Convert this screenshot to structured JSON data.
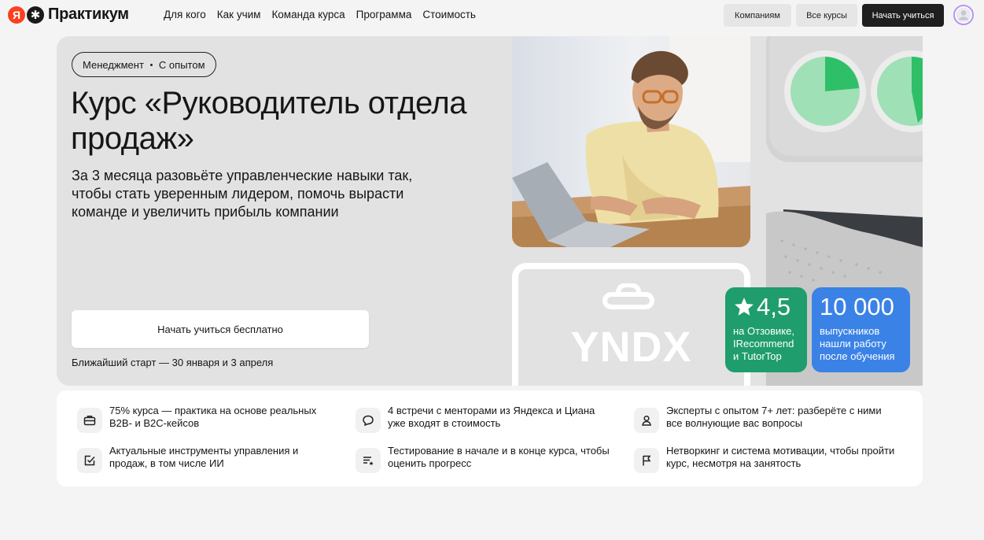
{
  "header": {
    "logo": {
      "ya_letter": "Я",
      "text": "Практикум"
    },
    "nav": [
      "Для кого",
      "Как учим",
      "Команда курса",
      "Программа",
      "Стоимость"
    ],
    "buttons": {
      "companies": "Компаниям",
      "all_courses": "Все курсы",
      "start": "Начать учиться"
    }
  },
  "hero": {
    "tag": {
      "category": "Менеджмент",
      "level": "С опытом"
    },
    "title": "Курс «Руководитель отдела продаж»",
    "subtitle": "За 3 месяца разовьёте управленческие навыки так, чтобы стать уверенным лидером, помочь вырасти команде и увеличить прибыль компании",
    "cta": "Начать учиться бесплатно",
    "next_start": "Ближайший старт — 30 января и 3 апреля",
    "card_text": "YNDX",
    "rating": {
      "value": "4,5",
      "caption": "на Отзовике, IRecommend и TutorTop"
    },
    "graduates": {
      "value": "10 000",
      "caption": "выпускников нашли работу после обучения"
    }
  },
  "features": [
    {
      "icon": "briefcase-icon",
      "text": "75% курса — практика на основе реальных B2B- и B2C-кейсов"
    },
    {
      "icon": "chat-icon",
      "text": "4 встречи с менторами из Яндекса и Циана уже входят в стоимость"
    },
    {
      "icon": "person-icon",
      "text": "Эксперты с опытом 7+ лет: разберёте с ними все волнующие вас вопросы"
    },
    {
      "icon": "checkbox-icon",
      "text": "Актуальные инструменты управления и продаж, в том числе ИИ"
    },
    {
      "icon": "list-star-icon",
      "text": "Тестирование в начале и в конце курса, чтобы оценить прогресс"
    },
    {
      "icon": "flag-icon",
      "text": "Нетворкинг и система мотивации, чтобы пройти курс, несмотря на занятость"
    }
  ],
  "colors": {
    "accent_dark": "#1f1f1f",
    "rating_green": "#1f9d6d",
    "graduates_blue": "#3b82e6",
    "logo_red": "#fc3f1d"
  }
}
